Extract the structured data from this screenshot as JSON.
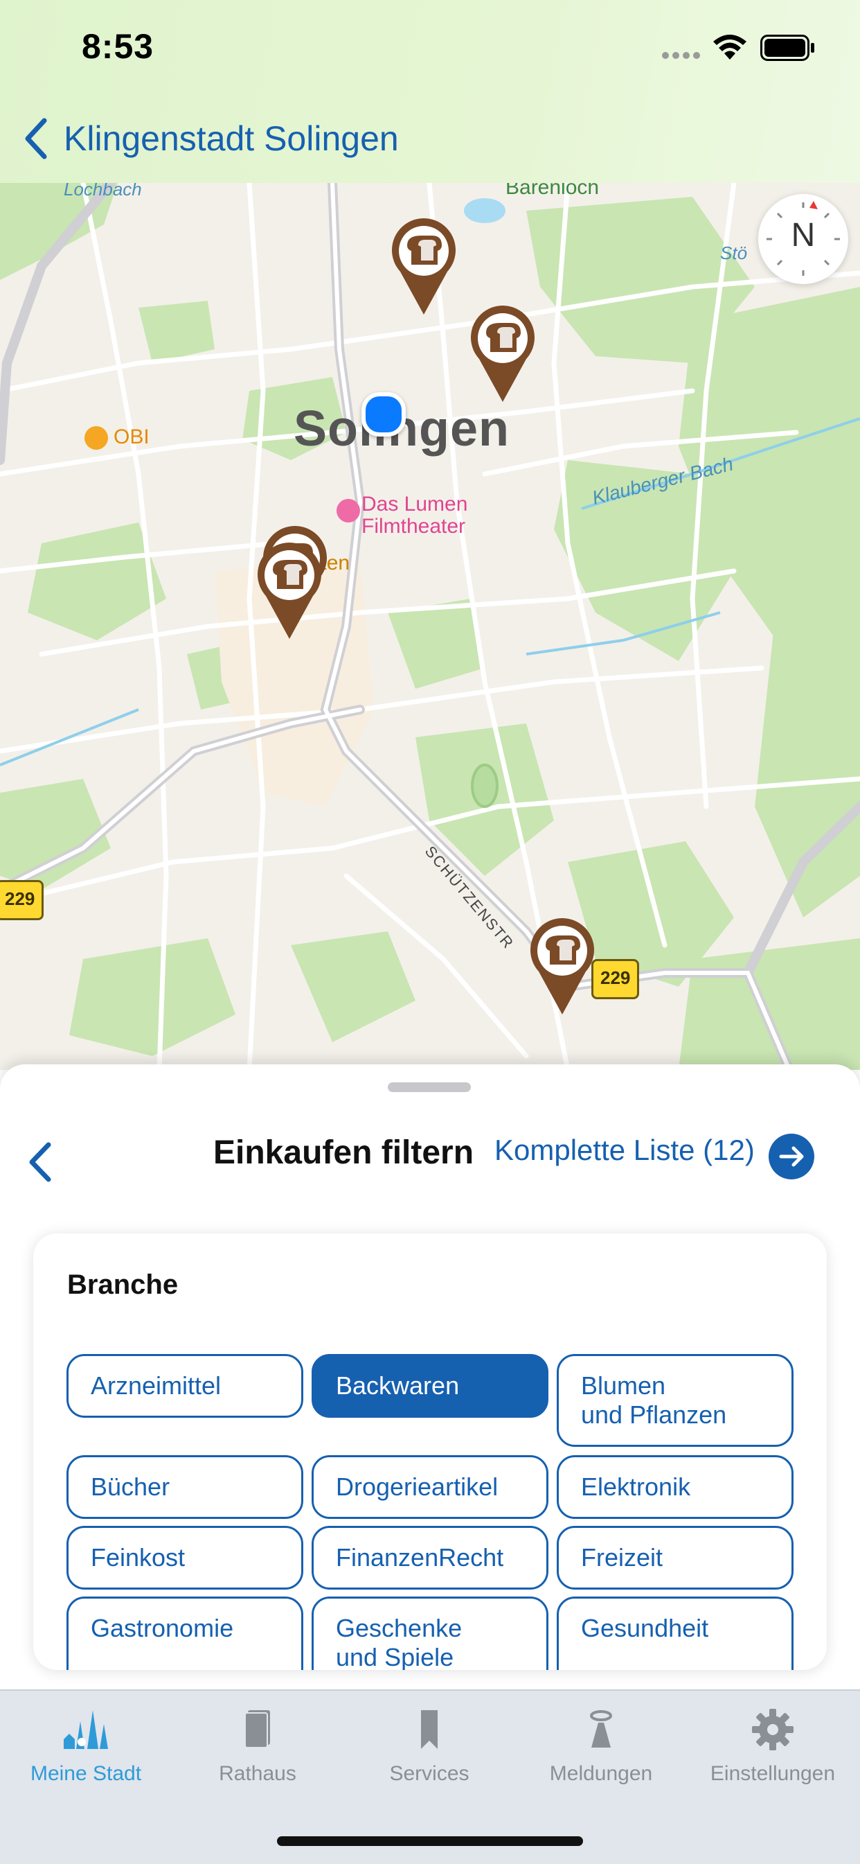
{
  "status_bar": {
    "time": "8:53"
  },
  "nav": {
    "back_title": "Klingenstadt Solingen"
  },
  "map": {
    "city_label": "Solingen",
    "poi_obi": "OBI",
    "poi_lumen_line1": "Das Lumen",
    "poi_lumen_line2": "Filmtheater",
    "poi_garten": "garten",
    "stream_lochbach": "Lochbach",
    "stream_klauberger": "Klauberger Bach",
    "place_top": "Bärenloch",
    "place_right": "Stö",
    "street_schuetzen": "SCHÜTZENSTR",
    "route_label": "229",
    "compass_label": "N",
    "pin_icon": "bread-icon",
    "pin_color": "#7b4a26",
    "user_location_color": "#0a7aff"
  },
  "sheet": {
    "title": "Einkaufen filtern",
    "full_list_label": "Komplette Liste (12)",
    "card_title": "Branche",
    "chips": [
      {
        "label": "Arzneimittel",
        "selected": false
      },
      {
        "label": "Backwaren",
        "selected": true
      },
      {
        "label": "Blumen\nund Pflanzen",
        "selected": false
      },
      {
        "label": "Bücher",
        "selected": false
      },
      {
        "label": "Drogerieartikel",
        "selected": false
      },
      {
        "label": "Elektronik",
        "selected": false
      },
      {
        "label": "Feinkost",
        "selected": false
      },
      {
        "label": "FinanzenRecht",
        "selected": false
      },
      {
        "label": "Freizeit",
        "selected": false
      },
      {
        "label": "Gastronomie",
        "selected": false
      },
      {
        "label": "Geschenke\nund Spiele",
        "selected": false
      },
      {
        "label": "Gesundheit",
        "selected": false
      }
    ]
  },
  "tabbar": {
    "items": [
      {
        "label": "Meine Stadt",
        "icon": "city-icon",
        "active": true
      },
      {
        "label": "Rathaus",
        "icon": "book-icon",
        "active": false
      },
      {
        "label": "Services",
        "icon": "bookmark-icon",
        "active": false
      },
      {
        "label": "Meldungen",
        "icon": "megaphone-icon",
        "active": false
      },
      {
        "label": "Einstellungen",
        "icon": "gear-icon",
        "active": false
      }
    ]
  },
  "colors": {
    "accent": "#1660b0",
    "tab_active": "#2e9bd8",
    "tab_inactive": "#8a8f96",
    "header_bg": "#e3f5d2"
  }
}
